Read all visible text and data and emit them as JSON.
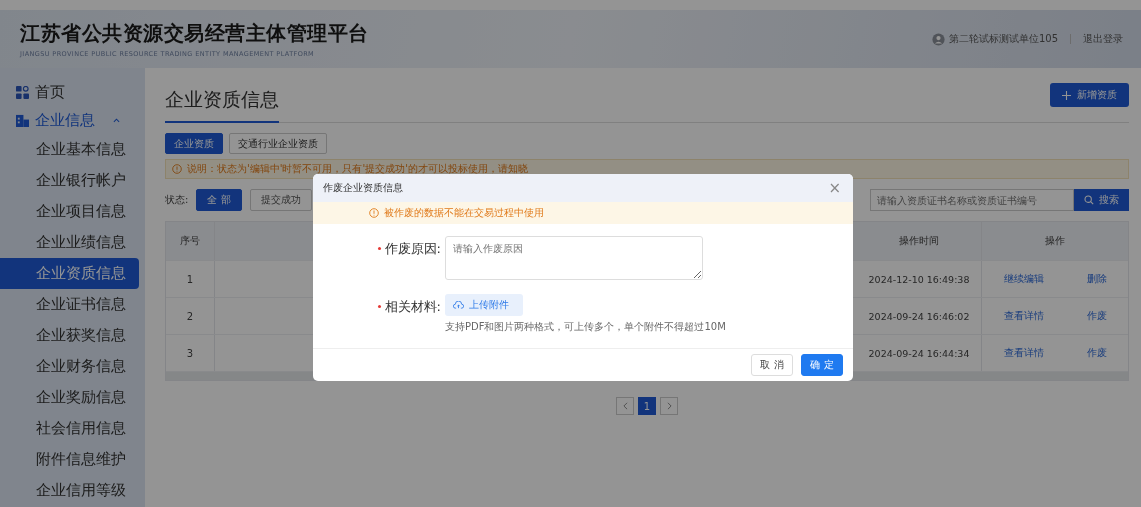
{
  "header": {
    "title": "江苏省公共资源交易经营主体管理平台",
    "subtitle": "JIANGSU PROVINCE PUBLIC RESOURCE TRADING ENTITY MANAGEMENT PLATFORM",
    "user": "第二轮试标测试单位105",
    "logout": "退出登录"
  },
  "sidebar": {
    "items": [
      {
        "label": "首页",
        "expanded": false
      },
      {
        "label": "企业信息",
        "expanded": true,
        "children": [
          {
            "label": "企业基本信息",
            "selected": false
          },
          {
            "label": "企业银行帐户",
            "selected": false
          },
          {
            "label": "企业项目信息",
            "selected": false
          },
          {
            "label": "企业业绩信息",
            "selected": false
          },
          {
            "label": "企业资质信息",
            "selected": true
          },
          {
            "label": "企业证书信息",
            "selected": false
          },
          {
            "label": "企业获奖信息",
            "selected": false
          },
          {
            "label": "企业财务信息",
            "selected": false
          },
          {
            "label": "企业奖励信息",
            "selected": false
          },
          {
            "label": "社会信用信息",
            "selected": false
          },
          {
            "label": "附件信息维护",
            "selected": false
          },
          {
            "label": "企业信用等级",
            "selected": false
          }
        ]
      }
    ]
  },
  "page": {
    "title": "企业资质信息",
    "add_button": "新增资质",
    "tabs": [
      {
        "label": "企业资质",
        "selected": true
      },
      {
        "label": "交通行业企业资质",
        "selected": false
      }
    ],
    "notice": "说明：状态为'编辑中'时暂不可用，只有'提交成功'的才可以投标使用，请知晓",
    "status_label": "状态:",
    "status_filters": [
      {
        "label": "全 部",
        "selected": true
      },
      {
        "label": "提交成功",
        "selected": false
      }
    ],
    "search": {
      "placeholder": "请输入资质证书名称或资质证书编号",
      "button": "搜索"
    }
  },
  "table": {
    "columns": [
      "序号",
      "操作时间",
      "操作"
    ],
    "rows": [
      {
        "index": "1",
        "time": "2024-12-10 16:49:38",
        "actions": [
          "继续编辑",
          "删除"
        ]
      },
      {
        "index": "2",
        "time": "2024-09-24 16:46:02",
        "actions": [
          "查看详情",
          "作废"
        ]
      },
      {
        "index": "3",
        "time": "2024-09-24 16:44:34",
        "actions": [
          "查看详情",
          "作废"
        ]
      }
    ]
  },
  "pagination": {
    "pages": [
      {
        "label": "1",
        "selected": true
      }
    ]
  },
  "dialog": {
    "title": "作废企业资质信息",
    "close": "×",
    "warning": "被作废的数据不能在交易过程中使用",
    "fields": [
      {
        "kind": "textarea",
        "label": "作废原因:",
        "required": true,
        "placeholder": "请输入作废原因"
      },
      {
        "kind": "upload",
        "label": "相关材料:",
        "required": true,
        "button": "上传附件",
        "hint": "支持PDF和图片两种格式，可上传多个，单个附件不得超过10M"
      }
    ],
    "buttons": [
      {
        "label": "取 消",
        "kind": "cancel"
      },
      {
        "label": "确 定",
        "kind": "primary"
      }
    ]
  }
}
